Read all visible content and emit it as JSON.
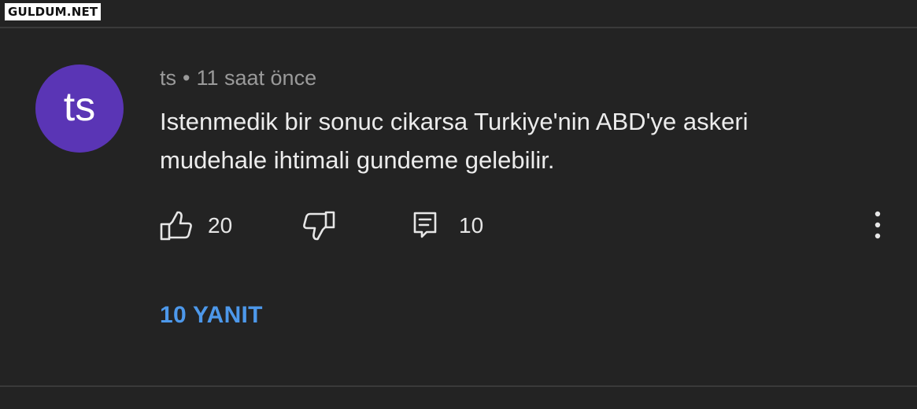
{
  "watermark": "GULDUM.NET",
  "comment": {
    "avatar_initials": "ts",
    "avatar_color": "#5a35b5",
    "author": "ts",
    "separator": "•",
    "time": "11 saat önce",
    "text": "Istenmedik bir sonuc cikarsa Turkiye'nin ABD'ye askeri mudehale ihtimali gundeme gelebilir.",
    "likes": "20",
    "reply_count": "10",
    "replies_button": "10 YANIT"
  },
  "icons": {
    "like": "thumbs-up-icon",
    "dislike": "thumbs-down-icon",
    "reply": "comment-icon",
    "more": "more-vertical-icon"
  },
  "colors": {
    "background": "#232323",
    "text": "#ececec",
    "meta": "#9a9a9a",
    "link": "#4d98ea"
  }
}
